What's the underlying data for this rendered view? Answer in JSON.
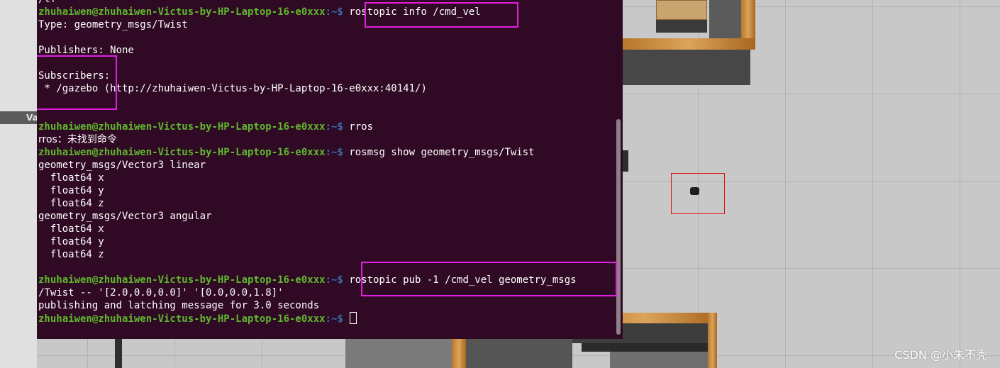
{
  "terminal": {
    "prompt_user": "zhuhaiwen@zhuhaiwen-Victus-by-HP-Laptop-16-e0xxx",
    "prompt_path": ":~$ ",
    "cut_line": "/tf",
    "cmd_info": "rostopic info /cmd_vel",
    "type_line": "Type: geometry_msgs/Twist",
    "publishers_line": "Publishers: None",
    "subscribers_label": "Subscribers:",
    "subscriber_entry": " * /gazebo (http://zhuhaiwen-Victus-by-HP-Laptop-16-e0xxx:40141/)",
    "cmd_rros": "rros",
    "rros_error": "rros：未找到命令",
    "cmd_rosmsg": "rosmsg show geometry_msgs/Twist",
    "msg_lines": [
      "geometry_msgs/Vector3 linear",
      "  float64 x",
      "  float64 y",
      "  float64 z",
      "geometry_msgs/Vector3 angular",
      "  float64 x",
      "  float64 y",
      "  float64 z"
    ],
    "cmd_pub_part1": "rostopic pub -1 /cmd_vel geometry_msgs",
    "cmd_pub_part2": "/Twist -- '[2.0,0.0,0.0]' '[0.0,0.0,1.8]'",
    "pub_output": "publishing and latching message for 3.0 seconds"
  },
  "gazebo": {
    "left_tab_label": "Va"
  },
  "watermark": "CSDN @小朱不秃",
  "colors": {
    "terminal_bg": "#300a24",
    "prompt_user": "#5fb82e",
    "prompt_path": "#3c6eb4",
    "highlight": "#e020e0",
    "marker": "#e01010"
  }
}
